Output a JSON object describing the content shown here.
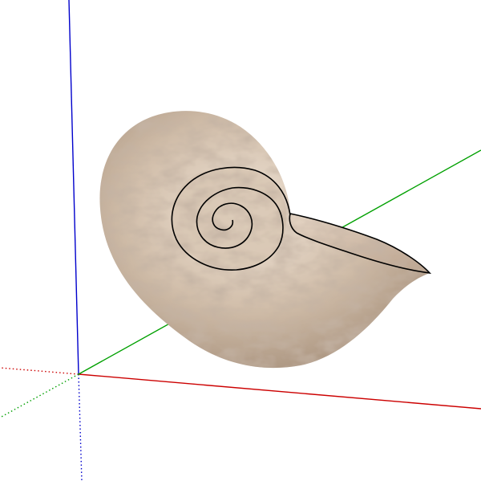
{
  "viewport": {
    "background_color": "#ffffff",
    "axes": {
      "x_color": "#cc0000",
      "y_color": "#00a000",
      "z_color": "#0000cc",
      "negative_style": "dotted"
    },
    "model": {
      "name": "nautilus-shell",
      "base_color": "#cdb9a4",
      "shadow_color": "#8f7a66",
      "highlight_color": "#f2e7dc",
      "edge_color": "#000000"
    }
  }
}
